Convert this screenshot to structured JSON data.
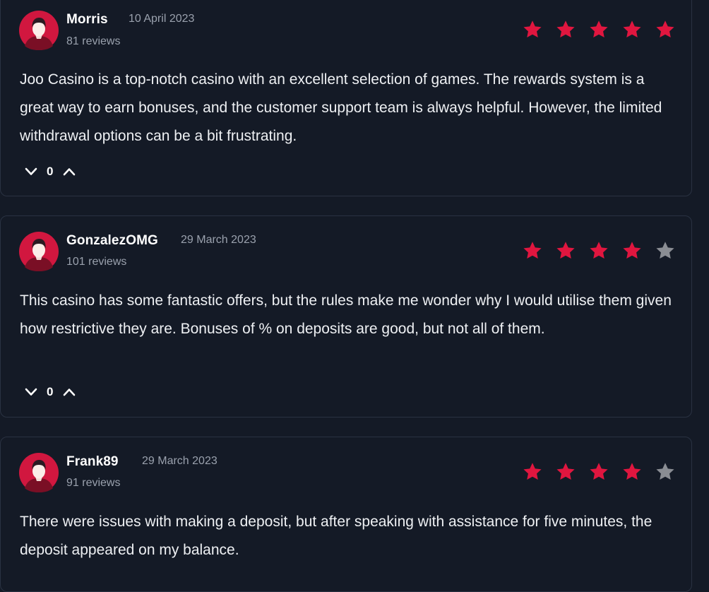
{
  "colors": {
    "background": "#141a26",
    "card_border": "#2a3242",
    "star_filled": "#e0163f",
    "star_empty": "#8a8d93",
    "avatar_red": "#d1173f"
  },
  "icons": {
    "avatar": "user-avatar-icon",
    "star": "star-icon",
    "downvote": "chevron-down-icon",
    "upvote": "chevron-up-icon"
  },
  "reviews": [
    {
      "author": "Morris",
      "date": "10 April 2023",
      "review_count": "81 reviews",
      "rating": 5,
      "max_rating": 5,
      "text": "Joo Casino is a top-notch casino with an excellent selection of games. The rewards system is a great way to earn bonuses, and the customer support team is always helpful. However, the limited withdrawal options can be a bit frustrating.",
      "votes": "0"
    },
    {
      "author": "GonzalezOMG",
      "date": "29 March 2023",
      "review_count": "101 reviews",
      "rating": 4,
      "max_rating": 5,
      "text": "This casino has some fantastic offers, but the rules make me wonder why I would utilise them given how restrictive they are. Bonuses of % on deposits are good, but not all of them.",
      "votes": "0"
    },
    {
      "author": "Frank89",
      "date": "29 March 2023",
      "review_count": "91 reviews",
      "rating": 4,
      "max_rating": 5,
      "text": "There were issues with making a deposit, but after speaking with assistance for five minutes, the deposit appeared on my balance."
    }
  ]
}
